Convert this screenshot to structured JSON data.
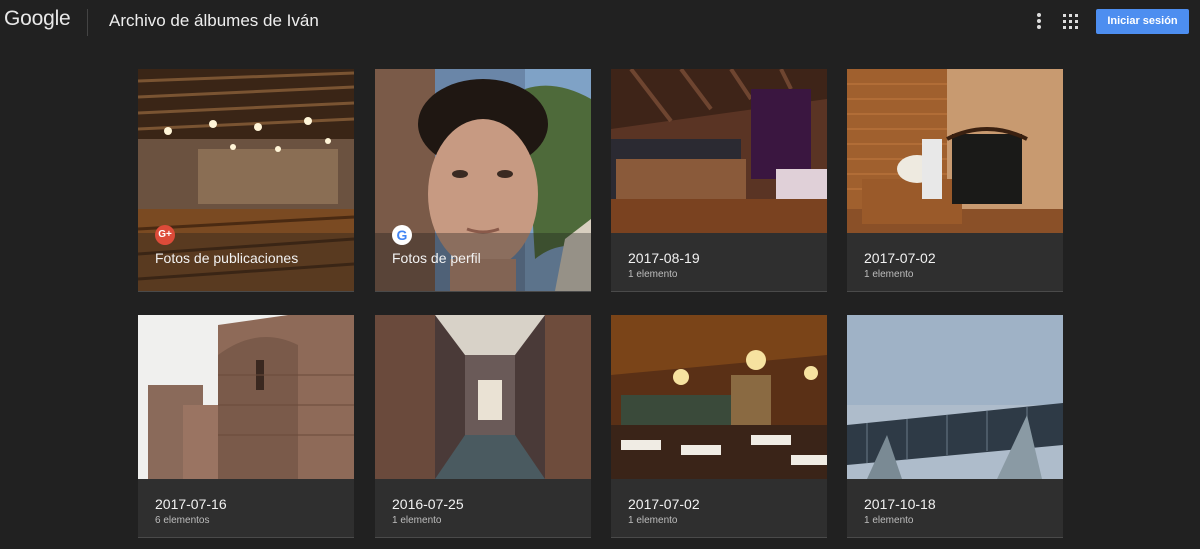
{
  "header": {
    "logo": "Google",
    "title": "Archivo de álbumes de Iván",
    "signin_label": "Iniciar sesión"
  },
  "colors": {
    "background": "#212121",
    "card": "#2f2f2f",
    "accent": "#4d8ef0"
  },
  "albums": [
    {
      "name": "Fotos de publicaciones",
      "count": "",
      "badge": "G+",
      "badge_icon": "google-plus-icon"
    },
    {
      "name": "Fotos de perfil",
      "count": "",
      "badge": "G",
      "badge_icon": "google-icon"
    },
    {
      "name": "2017-08-19",
      "count": "1 elemento"
    },
    {
      "name": "2017-07-02",
      "count": "1 elemento"
    },
    {
      "name": "2017-07-16",
      "count": "6 elementos"
    },
    {
      "name": "2016-07-25",
      "count": "1 elemento"
    },
    {
      "name": "2017-07-02",
      "count": "1 elemento"
    },
    {
      "name": "2017-10-18",
      "count": "1 elemento"
    }
  ]
}
